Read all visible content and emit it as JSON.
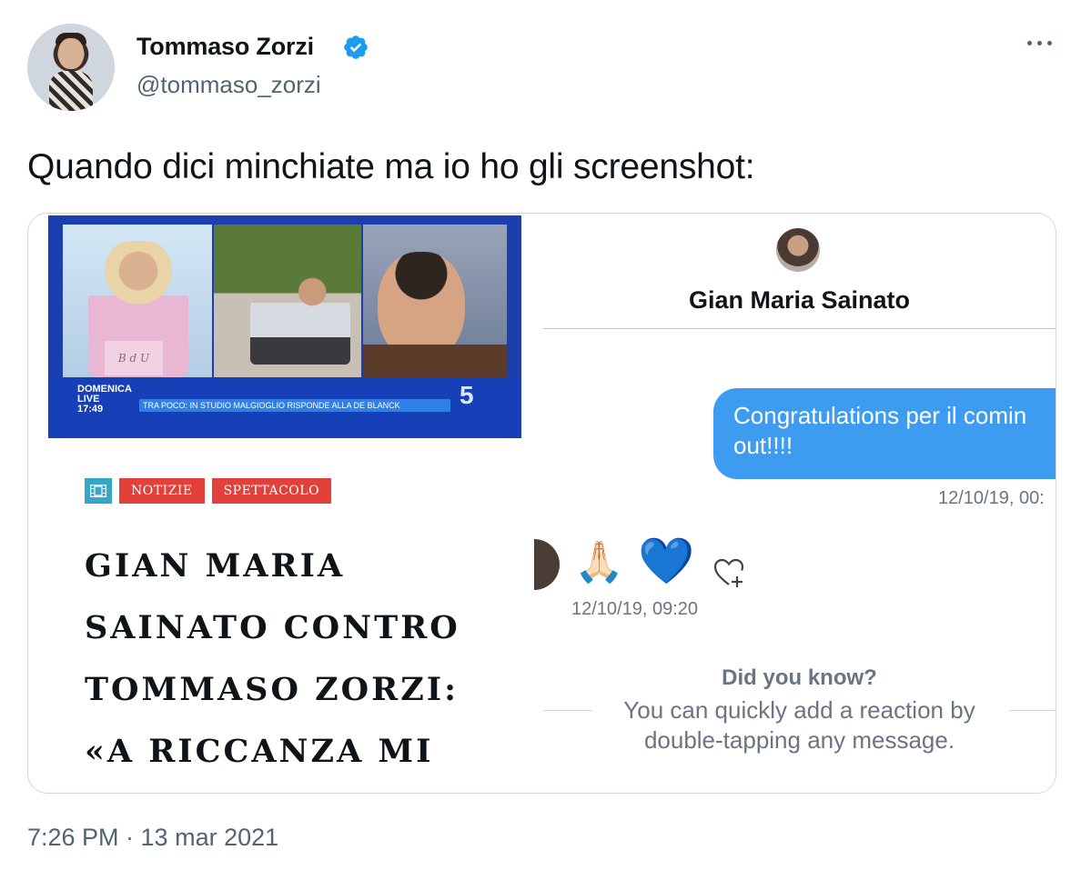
{
  "author": {
    "name": "Tommaso Zorzi",
    "handle": "@tommaso_zorzi",
    "verified": true
  },
  "tweet": {
    "text": "Quando dici minchiate ma io ho gli screenshot:",
    "timestamp": "7:26 PM · 13 mar 2021"
  },
  "news_image": {
    "tv_logo": "DOMENICA\nLIVE\n17:49",
    "ticker": "TRA POCO: IN STUDIO MALGIOGLIO RISPONDE ALLA DE BLANCK",
    "sign_text": "B d U",
    "channel": "5",
    "tags": [
      "NOTIZIE",
      "SPETTACOLO"
    ],
    "headline_lines": [
      "GIAN MARIA",
      "SAINATO CONTRO",
      "TOMMASO ZORZI:",
      "«A RICCANZA MI"
    ]
  },
  "dm_image": {
    "contact_name": "Gian Maria Sainato",
    "message": "Congratulations per il comin\nout!!!!",
    "message_time": "12/10/19, 00:",
    "reactions": [
      "🙏🏻",
      "💙"
    ],
    "reaction_time": "12/10/19, 09:20",
    "tip_title": "Did you know?",
    "tip_body": "You can quickly add a reaction by\ndouble-tapping any message."
  },
  "colors": {
    "accent": "#1d9bf0",
    "bubble": "#3d9bf0",
    "tag_red": "#e2403a",
    "tag_blue": "#36a7c9"
  }
}
